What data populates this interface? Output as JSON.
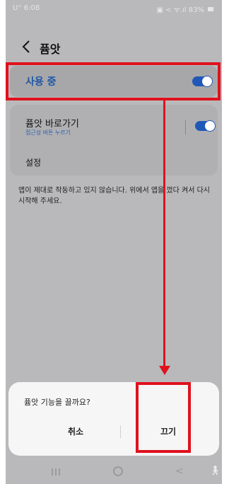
{
  "status_bar": {
    "time": "U⁺ 6:08",
    "right": "▣ ≺ ᯤ.ıl 83%"
  },
  "app_bar": {
    "title": "퓸앗"
  },
  "master_switch": {
    "label": "사용 중",
    "state": "on"
  },
  "shortcut": {
    "title": "퓸앗 바로가기",
    "subtitle": "접근성 버튼 누르기",
    "state": "on"
  },
  "settings": {
    "label": "설정"
  },
  "info": {
    "text": "앱이 제대로 작동하고 있지 않습니다. 위에서 앱을 껐다 켜서 다시 시작해 주세요."
  },
  "dialog": {
    "title": "퓸앗 기능을 끌까요?",
    "cancel_label": "취소",
    "confirm_label": "끄기"
  },
  "nav_bar": {
    "recent_icon": "recent-apps-icon",
    "home_icon": "home-icon",
    "back_icon": "back-icon",
    "accessibility_icon": "accessibility-icon"
  },
  "colors": {
    "accent": "#1f58b8",
    "highlight": "#e0111e",
    "dim_background": "#b9b9bb",
    "dialog_background": "#f6f6f6"
  }
}
